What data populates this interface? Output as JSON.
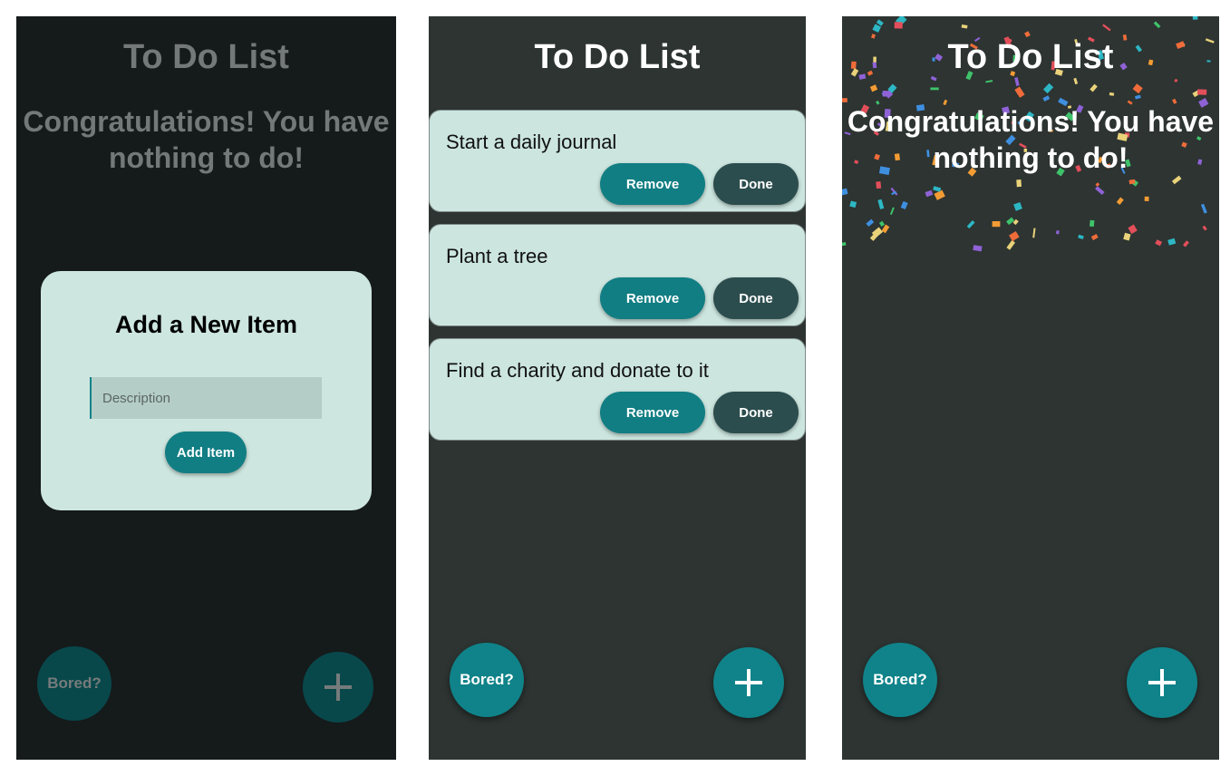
{
  "screens": [
    {
      "title": "To Do List",
      "congrats": "Congratulations! You have nothing to do!",
      "dialog": {
        "title": "Add a New Item",
        "input_placeholder": "Description",
        "input_value": "",
        "button_label": "Add Item"
      },
      "bored_label": "Bored?",
      "add_icon": "plus-icon"
    },
    {
      "title": "To Do List",
      "items": [
        {
          "text": "Start a daily journal",
          "remove_label": "Remove",
          "done_label": "Done"
        },
        {
          "text": "Plant a tree",
          "remove_label": "Remove",
          "done_label": "Done"
        },
        {
          "text": "Find a charity and donate to it",
          "remove_label": "Remove",
          "done_label": "Done"
        }
      ],
      "bored_label": "Bored?",
      "add_icon": "plus-icon"
    },
    {
      "title": "To Do List",
      "congrats": "Congratulations! You have nothing to do!",
      "bored_label": "Bored?",
      "add_icon": "plus-icon",
      "confetti": "confetti-animation"
    }
  ],
  "colors": {
    "background": "#2d3432",
    "dimmed_background": "#151a1b",
    "card": "#cce5df",
    "accent": "#0f8389",
    "done_button": "#2c4d4e",
    "input": "#b5cdc7"
  }
}
